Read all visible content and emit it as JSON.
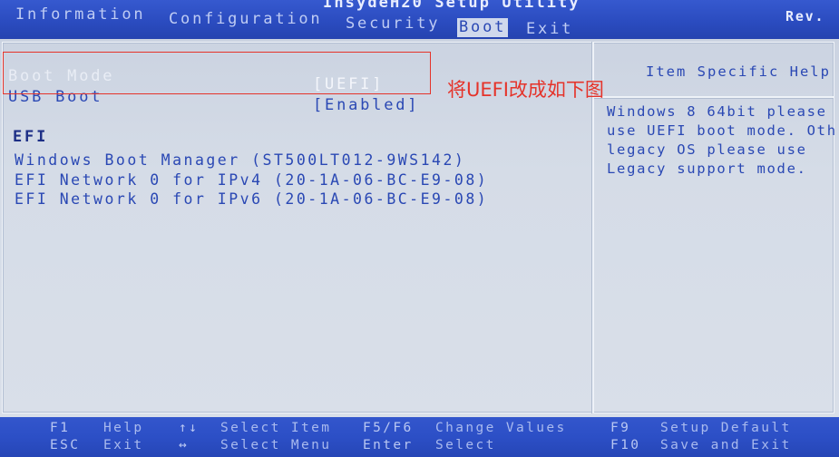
{
  "title": "InsydeH20 Setup Utility",
  "rev": "Rev.",
  "tabs": [
    {
      "label": "Information",
      "selected": false
    },
    {
      "label": "Configuration",
      "selected": false
    },
    {
      "label": "Security",
      "selected": false
    },
    {
      "label": "Boot",
      "selected": true
    },
    {
      "label": "Exit",
      "selected": false
    }
  ],
  "settings": [
    {
      "label": "Boot Mode",
      "value": "[UEFI]",
      "selected": true
    },
    {
      "label": "USB Boot",
      "value": "[Enabled]",
      "selected": false
    }
  ],
  "efi": {
    "heading": "EFI",
    "entries": [
      "Windows Boot Manager (ST500LT012-9WS142)",
      "EFI Network 0 for IPv4 (20-1A-06-BC-E9-08)",
      "EFI Network 0 for IPv6 (20-1A-06-BC-E9-08)"
    ]
  },
  "help": {
    "title": "Item Specific Help",
    "lines": [
      "Windows 8 64bit please",
      "use UEFI boot mode. Oth",
      "legacy OS please use",
      "Legacy support mode."
    ]
  },
  "annotation": {
    "text": "将UEFI改成如下图"
  },
  "footer": {
    "hints": [
      [
        {
          "key": "F1",
          "action": "Help"
        },
        {
          "key": "↑↓",
          "action": "Select Item"
        },
        {
          "key": "F5/F6",
          "action": "Change Values"
        },
        {
          "key": "F9",
          "action": "Setup Default"
        }
      ],
      [
        {
          "key": "ESC",
          "action": "Exit"
        },
        {
          "key": "↔",
          "action": "Select Menu"
        },
        {
          "key": "Enter",
          "action": "Select"
        },
        {
          "key": "F10",
          "action": "Save and Exit"
        }
      ]
    ]
  },
  "colors": {
    "header_bg": "#2b4cc0",
    "panel_bg": "#d5dce7",
    "text": "#2a48b4",
    "selected_text": "#f4f6fb",
    "tab_selected_bg": "#cfd8ec",
    "annotation": "#e5332a",
    "footer_bg": "#2c4fc6",
    "footer_text": "#a9baee"
  }
}
